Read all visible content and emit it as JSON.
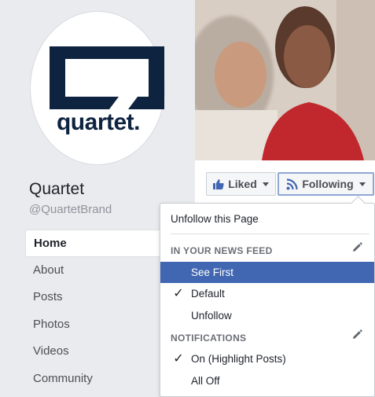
{
  "page": {
    "name": "Quartet",
    "handle": "@QuartetBrand",
    "logo_text": "quartet."
  },
  "nav": [
    {
      "label": "Home",
      "active": true
    },
    {
      "label": "About"
    },
    {
      "label": "Posts"
    },
    {
      "label": "Photos"
    },
    {
      "label": "Videos"
    },
    {
      "label": "Community"
    }
  ],
  "actions": {
    "liked_label": "Liked",
    "following_label": "Following"
  },
  "dropdown": {
    "unfollow_page": "Unfollow this Page",
    "news_feed_header": "IN YOUR NEWS FEED",
    "news_feed_options": [
      {
        "label": "See First",
        "selected": true,
        "checked": false
      },
      {
        "label": "Default",
        "selected": false,
        "checked": true
      },
      {
        "label": "Unfollow",
        "selected": false,
        "checked": false
      }
    ],
    "notifications_header": "NOTIFICATIONS",
    "notification_options": [
      {
        "label": "On (Highlight Posts)",
        "checked": true
      },
      {
        "label": "All Off",
        "checked": false
      }
    ],
    "check_glyph": "✓"
  },
  "colors": {
    "brand_navy": "#0e2340",
    "selection_blue": "#4267b2",
    "like_blue": "#4267b2"
  }
}
